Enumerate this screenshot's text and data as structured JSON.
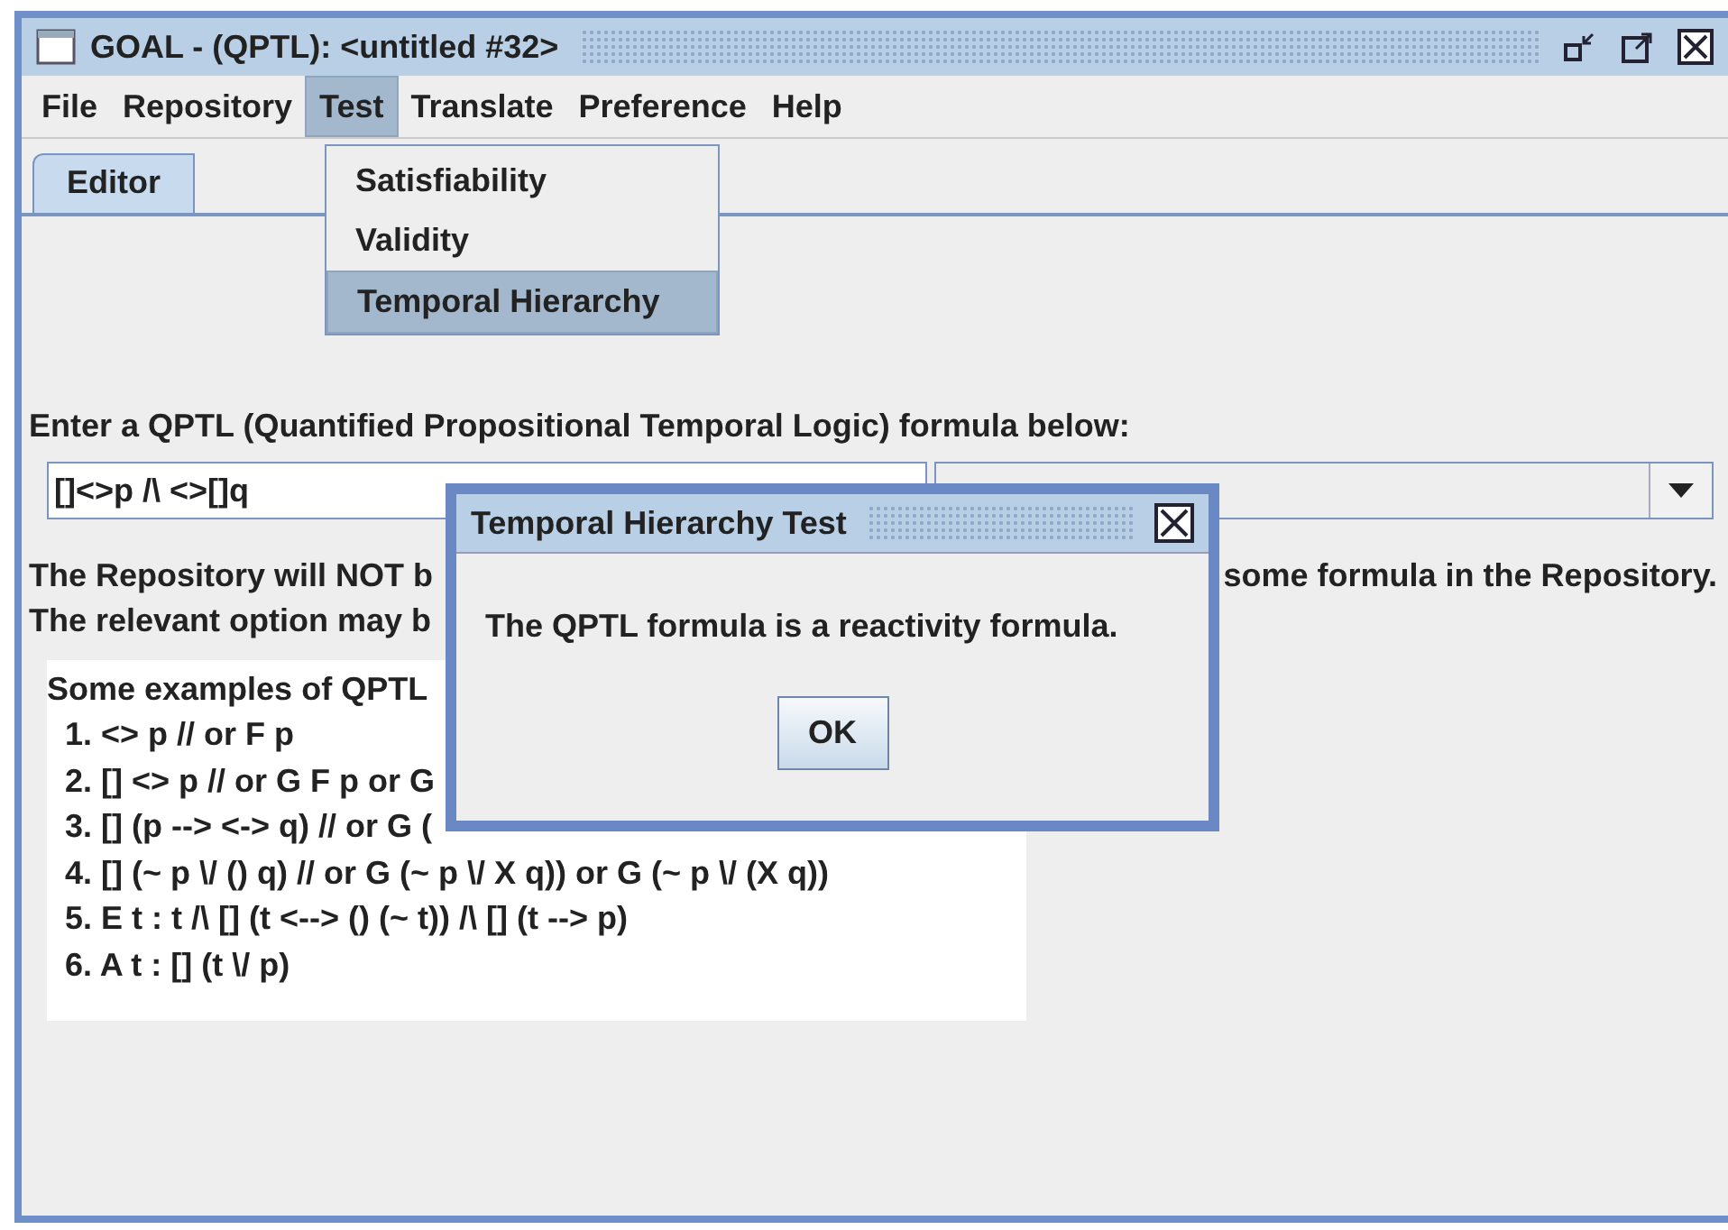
{
  "window": {
    "title": "GOAL - (QPTL): <untitled #32>"
  },
  "menu_bar": [
    {
      "label": "File",
      "selected": false
    },
    {
      "label": "Repository",
      "selected": false
    },
    {
      "label": "Test",
      "selected": true
    },
    {
      "label": "Translate",
      "selected": false
    },
    {
      "label": "Preference",
      "selected": false
    },
    {
      "label": "Help",
      "selected": false
    }
  ],
  "open_menu": {
    "items": [
      {
        "label": "Satisfiability",
        "selected": false
      },
      {
        "label": "Validity",
        "selected": false
      },
      {
        "label": "Temporal Hierarchy",
        "selected": true
      }
    ]
  },
  "tabs": [
    {
      "label": "Editor",
      "selected": true
    }
  ],
  "editor": {
    "prompt": "Enter a QPTL (Quantified Propositional Temporal Logic) formula below:",
    "formula_field": {
      "value": "[]<>p /\\ <>[]q"
    },
    "notes": [
      {
        "left": "The Repository will NOT b",
        "right": "some formula in the Repository."
      },
      {
        "left": "The relevant option may b"
      }
    ],
    "examples": {
      "heading": "Some examples of QPTL",
      "items": [
        "1. <> p // or F p",
        "2. [] <> p // or G F p or G",
        "3. [] (p --> <-> q) // or G (",
        "4. [] (~ p \\/ () q) // or G (~ p \\/ X q)) or G (~ p \\/ (X q))",
        "5. E t : t /\\ [] (t <--> () (~ t)) /\\ [] (t --> p)",
        "6. A t : [] (t \\/ p)"
      ]
    }
  },
  "dialog": {
    "title": "Temporal Hierarchy Test",
    "message": "The QPTL formula is a reactivity formula.",
    "buttons": [
      "OK"
    ]
  }
}
